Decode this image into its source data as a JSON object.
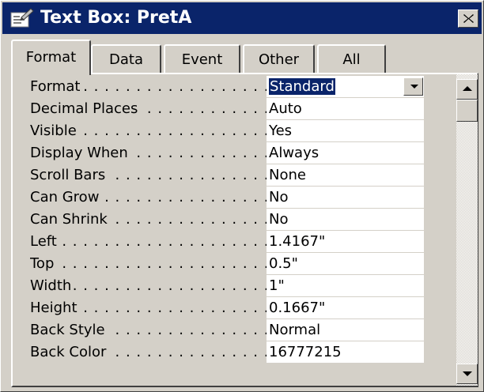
{
  "window": {
    "title": "Text Box: PretA",
    "title_icon": "properties-icon",
    "close_icon": "close-icon"
  },
  "tabs": [
    {
      "label": "Format",
      "active": true
    },
    {
      "label": "Data",
      "active": false
    },
    {
      "label": "Event",
      "active": false
    },
    {
      "label": "Other",
      "active": false
    },
    {
      "label": "All",
      "active": false
    }
  ],
  "properties": [
    {
      "label": "Format",
      "value": "Standard",
      "selected": true,
      "has_dropdown": true
    },
    {
      "label": "Decimal Places",
      "value": "Auto"
    },
    {
      "label": "Visible",
      "value": "Yes"
    },
    {
      "label": "Display When",
      "value": "Always"
    },
    {
      "label": "Scroll Bars",
      "value": "None"
    },
    {
      "label": "Can Grow",
      "value": "No"
    },
    {
      "label": "Can Shrink",
      "value": "No"
    },
    {
      "label": "Left",
      "value": "1.4167\""
    },
    {
      "label": "Top",
      "value": "0.5\""
    },
    {
      "label": "Width",
      "value": "1\""
    },
    {
      "label": "Height",
      "value": "0.1667\""
    },
    {
      "label": "Back Style",
      "value": "Normal"
    },
    {
      "label": "Back Color",
      "value": "16777215"
    }
  ],
  "colors": {
    "titlebar": "#0a246a",
    "face": "#d4d0c8",
    "selection": "#0a246a"
  }
}
